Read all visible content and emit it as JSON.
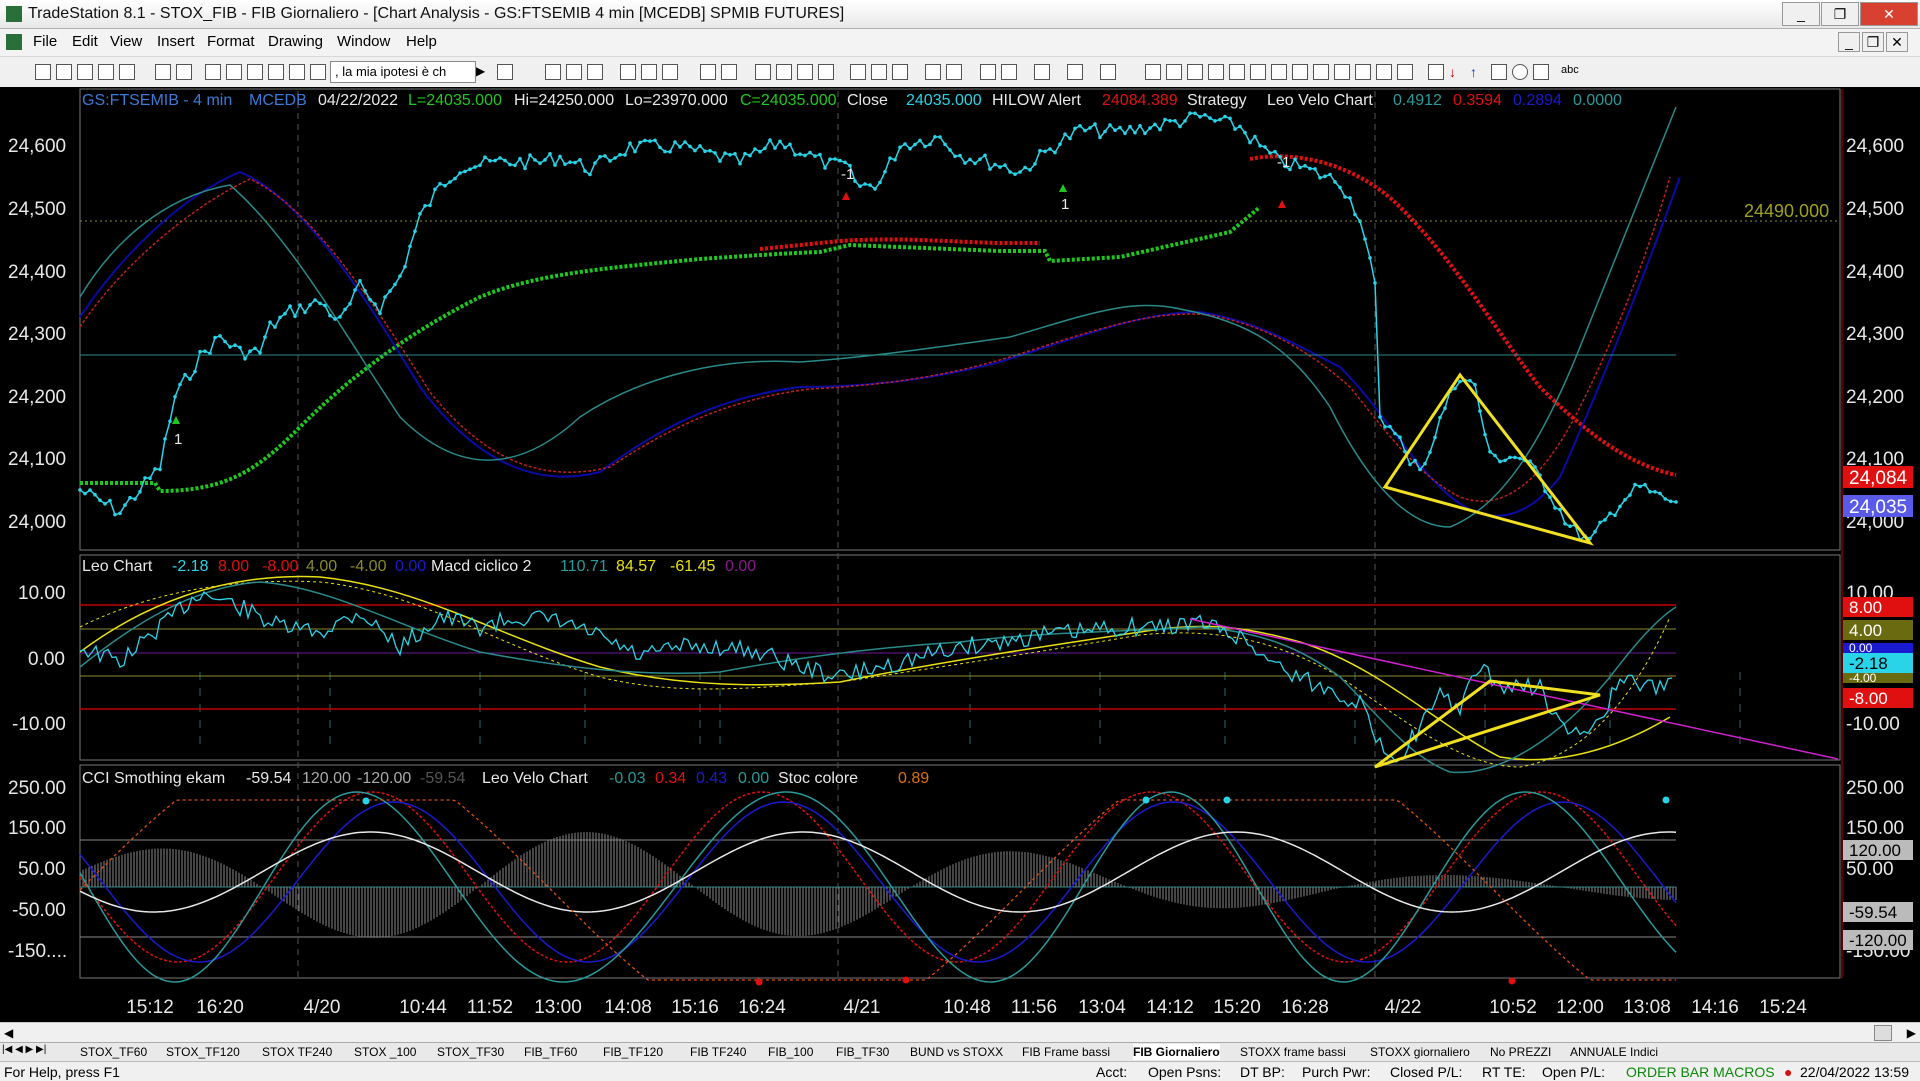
{
  "window": {
    "title": "TradeStation 8.1 - STOX_FIB - FIB Giornaliero - [Chart Analysis - GS:FTSEMIB  4 min  [MCEDB] SPMIB FUTURES]",
    "minimize": "_",
    "restore": "❐",
    "close": "✕"
  },
  "menu": [
    "File",
    "Edit",
    "View",
    "Insert",
    "Format",
    "Drawing",
    "Window",
    "Help"
  ],
  "toolbar": {
    "strategy_combo": ", la mia ipotesi è ch"
  },
  "chart": {
    "header": {
      "symbol": "GS:FTSEMIB - 4 min",
      "source": "MCEDB",
      "date": "04/22/2022",
      "last": "L=24035.000",
      "high": "Hi=24250.000",
      "low": "Lo=23970.000",
      "close_c": "C=24035.000",
      "close_label": "Close",
      "close_val": "24035.000",
      "hilow": "HILOW Alert",
      "hilow_val": "24084.389",
      "strategy": "Strategy",
      "leo": "Leo Velo Chart",
      "leo_v1": "0.4912",
      "leo_v2": "0.3594",
      "leo_v3": "0.2894",
      "leo_v4": "0.0000"
    },
    "price_axis": [
      "24,600",
      "24,500",
      "24,400",
      "24,300",
      "24,200",
      "24,100",
      "24,000"
    ],
    "price_level_label": "24490.000",
    "price_tags": {
      "red": "24,084",
      "blue": "24,035"
    },
    "trade_marks": [
      "1",
      "-1",
      "1",
      "-1"
    ],
    "panel2": {
      "title": "Leo Chart",
      "v1": "-2.18",
      "v2": "8.00",
      "v3": "-8.00",
      "v4": "4.00",
      "v5": "-4.00",
      "v6": "0.00",
      "title2": "Macd ciclico 2",
      "m1": "110.71",
      "m2": "84.57",
      "m3": "-61.45",
      "m4": "0.00",
      "axis": [
        "10.00",
        "0.00",
        "-10.00"
      ],
      "tags": [
        "8.00",
        "4.00",
        "0.00",
        "-2.18",
        "-4.00",
        "-8.00"
      ],
      "right_axis": [
        "10.00",
        "-10.00"
      ]
    },
    "panel3": {
      "title": "CCI Smothing ekam",
      "v1": "-59.54",
      "v2": "120.00",
      "v3": "-120.00",
      "v4": "-59.54",
      "title2": "Leo Velo Chart",
      "l1": "-0.03",
      "l2": "0.34",
      "l3": "0.43",
      "l4": "0.00",
      "title3": "Stoc colore",
      "s1": "0.89",
      "axis": [
        "250.00",
        "150.00",
        "50.00",
        "-50.00",
        "-150...."
      ],
      "tags": [
        "120.00",
        "-59.54",
        "-120.00"
      ],
      "right_axis": [
        "250.00",
        "150.00",
        "50.00",
        "-150.00"
      ]
    },
    "time_axis": [
      "15:12",
      "16:20",
      "4/20",
      "10:44",
      "11:52",
      "13:00",
      "14:08",
      "15:16",
      "16:24",
      "4/21",
      "10:48",
      "11:56",
      "13:04",
      "14:12",
      "15:20",
      "16:28",
      "4/22",
      "10:52",
      "12:00",
      "13:08",
      "14:16",
      "15:24"
    ]
  },
  "tabs": [
    "STOX_TF60",
    "STOX_TF120",
    "STOX TF240",
    "STOX _100",
    "STOX_TF30",
    "FIB_TF60",
    "FIB_TF120",
    "FIB TF240",
    "FIB_100",
    "FIB_TF30",
    "BUND vs STOXX",
    "FIB Frame bassi",
    "FIB Giornaliero",
    "STOXX frame bassi",
    "STOXX giornaliero",
    "No PREZZI",
    "ANNUALE Indici"
  ],
  "status": {
    "help": "For Help, press F1",
    "acct": "Acct:",
    "open_psns": "Open Psns:",
    "dt_bp": "DT BP:",
    "purch_pwr": "Purch Pwr:",
    "closed_pl": "Closed P/L:",
    "rt_te": "RT TE:",
    "open_pl": "Open P/L:",
    "macros": "ORDER BAR  MACROS",
    "datetime": "22/04/2022 13:59"
  }
}
